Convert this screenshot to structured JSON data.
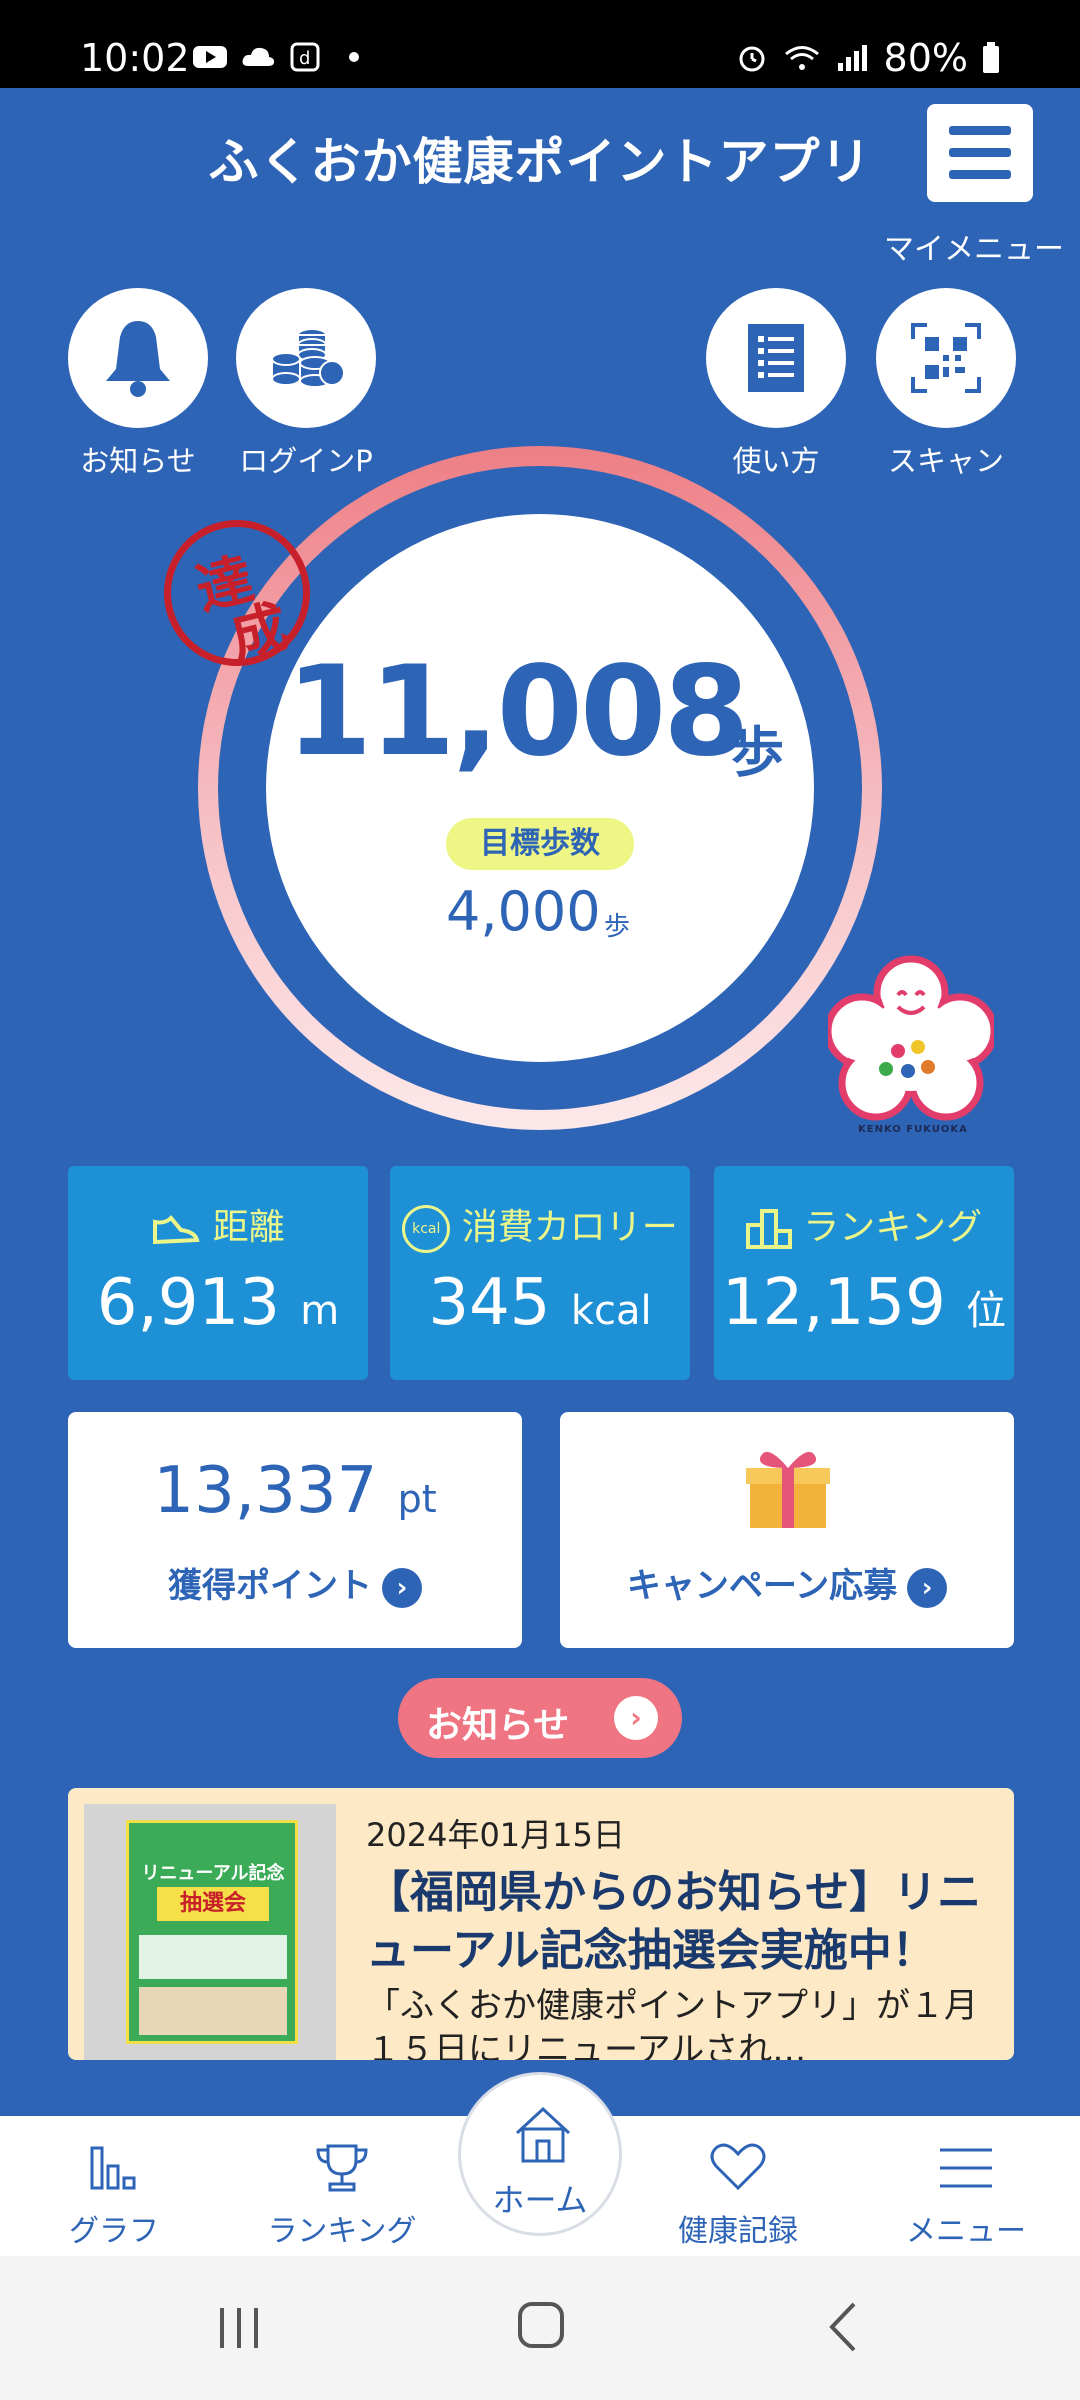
{
  "status_bar": {
    "time": "10:02",
    "battery": "80%"
  },
  "header": {
    "title": "ふくおか健康ポイントアプリ",
    "my_menu_label": "マイメニュー"
  },
  "quick_buttons": [
    {
      "label": "お知らせ",
      "icon": "bell-icon"
    },
    {
      "label": "ログインP",
      "icon": "coins-icon"
    },
    {
      "label": "使い方",
      "icon": "list-icon"
    },
    {
      "label": "スキャン",
      "icon": "qr-code-icon"
    }
  ],
  "steps": {
    "value": "11,008",
    "unit": "歩",
    "stamp_top": "達",
    "stamp_bottom": "成",
    "goal_label": "目標歩数",
    "goal_value": "4,000",
    "goal_unit": "歩"
  },
  "mascot": {
    "caption": "KENKO FUKUOKA"
  },
  "stats": {
    "distance": {
      "label": "距離",
      "value": "6,913",
      "unit": "m"
    },
    "calories": {
      "label": "消費カロリー",
      "value": "345",
      "unit": "kcal",
      "icon_text": "kcal"
    },
    "ranking": {
      "label": "ランキング",
      "value": "12,159",
      "unit": "位"
    }
  },
  "points": {
    "value": "13,337",
    "unit": "pt",
    "link": "獲得ポイント"
  },
  "campaign": {
    "link": "キャンペーン応募"
  },
  "news_button": {
    "label": "お知らせ"
  },
  "news": {
    "date": "2024年01月15日",
    "title": "【福岡県からのお知らせ】リニューアル記念抽選会実施中！",
    "body": "「ふくおか健康ポイントアプリ」が１月１５日にリニューアルされ…",
    "poster_title": "リニューアル記念",
    "poster_sub": "抽選会"
  },
  "bottom_nav": {
    "graph": "グラフ",
    "ranking": "ランキング",
    "home": "ホーム",
    "health": "健康記録",
    "menu": "メニュー"
  },
  "colors": {
    "primary": "#2e64b6",
    "accent_yellow": "#eaf58a",
    "stat_blue": "#1e90d6",
    "pink": "#f07583"
  }
}
